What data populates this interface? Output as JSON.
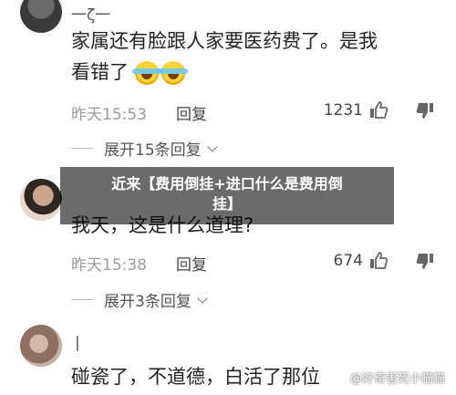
{
  "comments": [
    {
      "username": "一ζ一",
      "text_line1": "家属还有脸跟人家要医药费了。是我",
      "text_line2": "看错了",
      "emoji_count": 2,
      "time": "昨天15:53",
      "reply_label": "回复",
      "likes": "1231",
      "expand_label": "展开15条回复"
    },
    {
      "username": "",
      "text_line1": "我天，这是什么道理?",
      "time": "昨天15:38",
      "reply_label": "回复",
      "likes": "674",
      "expand_label": "展开3条回复"
    },
    {
      "username": "|",
      "text_line1": "碰瓷了，不道德，白活了那位",
      "partial": true
    }
  ],
  "banner": {
    "line1": "近来【费用倒挂+进口什么是费用倒",
    "line2": "挂】"
  },
  "watermark": "@好奇害死小猫猫",
  "icons": [
    "thumb-up-icon",
    "thumb-down-icon",
    "chevron-down-icon",
    "laugh-cry-emoji"
  ]
}
